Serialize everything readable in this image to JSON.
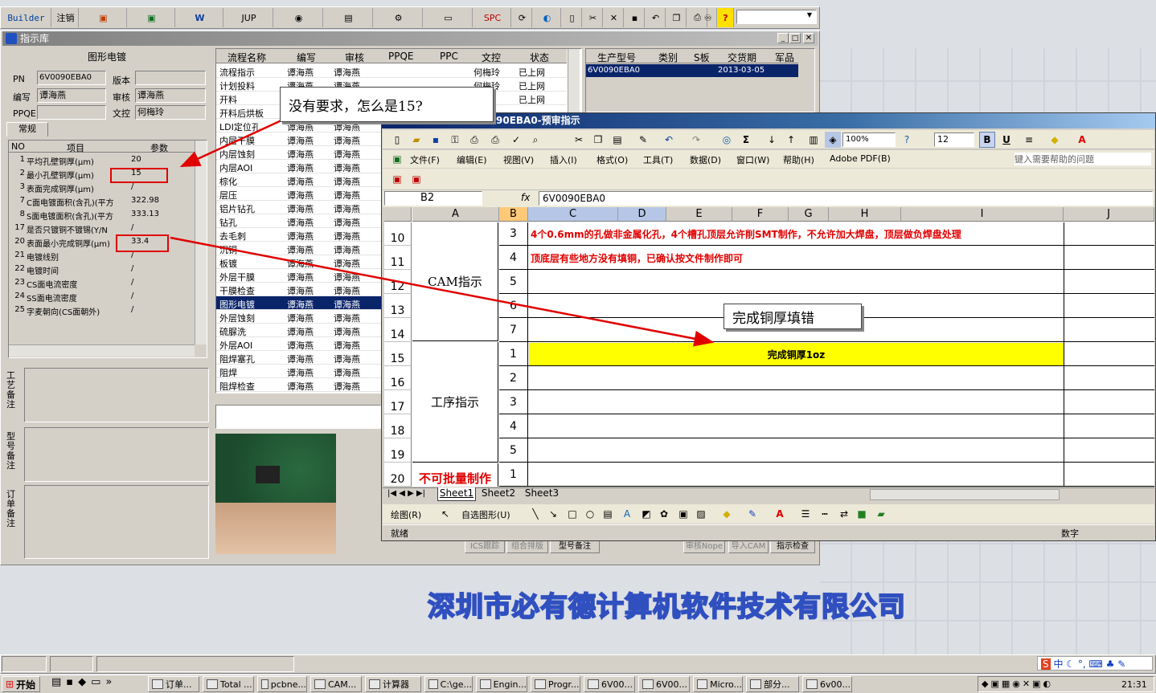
{
  "toolbar": {
    "builder": "Builder",
    "logout": "注销",
    "jup": "JUP",
    "spc": "SPC"
  },
  "panel": {
    "title": "指示库",
    "section": "图形电镀",
    "pn_label": "PN",
    "pn_value": "6V0090EBA0",
    "version_label": "版本",
    "editor_label": "编写",
    "editor_value": "谭海燕",
    "reviewer_label": "审核",
    "reviewer_value": "谭海燕",
    "pqpe_label": "PPQE",
    "docctrl_label": "文控",
    "docctrl_value": "何梅玲",
    "tab": "常规"
  },
  "param_table": {
    "headers": [
      "NO",
      "项目",
      "参数"
    ],
    "rows": [
      {
        "no": "1",
        "item": "平均孔壁铜厚(μm)",
        "val": "20"
      },
      {
        "no": "2",
        "item": "最小孔壁铜厚(μm)",
        "val": "15"
      },
      {
        "no": "3",
        "item": "表面完成铜厚(μm)",
        "val": "/"
      },
      {
        "no": "7",
        "item": "C面电镀面积(含孔)(平方",
        "val": "322.98"
      },
      {
        "no": "8",
        "item": "S面电镀面积(含孔)(平方",
        "val": "333.13"
      },
      {
        "no": "17",
        "item": "是否只镀铜不镀锡(Y/N",
        "val": "/"
      },
      {
        "no": "20",
        "item": "表面最小完成铜厚(μm)",
        "val": "33.4"
      },
      {
        "no": "21",
        "item": "电镀线别",
        "val": "/"
      },
      {
        "no": "22",
        "item": "电镀时间",
        "val": "/"
      },
      {
        "no": "23",
        "item": "CS面电流密度",
        "val": "/"
      },
      {
        "no": "24",
        "item": "SS面电流密度",
        "val": "/"
      },
      {
        "no": "25",
        "item": "字麦朝向(CS面朝外)",
        "val": "/"
      }
    ]
  },
  "notes": {
    "process": "工艺备注",
    "model": "型号备注",
    "order": "订单备注"
  },
  "flow_table": {
    "headers": [
      "流程名称",
      "编写",
      "审核",
      "PPQE",
      "PPC",
      "文控",
      "状态"
    ],
    "rows": [
      {
        "name": "流程指示",
        "w": "谭海燕",
        "r": "谭海燕",
        "dc": "何梅玲",
        "st": "已上网"
      },
      {
        "name": "计划投料",
        "w": "谭海燕",
        "r": "谭海燕",
        "dc": "何梅玲",
        "st": "已上网"
      },
      {
        "name": "开料",
        "w": "谭海燕",
        "r": "谭海燕",
        "dc": "",
        "st": "已上网"
      },
      {
        "name": "开料后烘板",
        "w": "谭海燕",
        "r": "谭海燕",
        "dc": "",
        "st": ""
      },
      {
        "name": "LDI定位孔",
        "w": "谭海燕",
        "r": "谭海燕",
        "dc": "",
        "st": ""
      },
      {
        "name": "内层干膜",
        "w": "谭海燕",
        "r": "谭海燕",
        "dc": "",
        "st": ""
      },
      {
        "name": "内层蚀刻",
        "w": "谭海燕",
        "r": "谭海燕",
        "dc": "",
        "st": ""
      },
      {
        "name": "内层AOI",
        "w": "谭海燕",
        "r": "谭海燕",
        "dc": "",
        "st": ""
      },
      {
        "name": "棕化",
        "w": "谭海燕",
        "r": "谭海燕",
        "dc": "",
        "st": ""
      },
      {
        "name": "层压",
        "w": "谭海燕",
        "r": "谭海燕",
        "dc": "",
        "st": ""
      },
      {
        "name": "铝片钻孔",
        "w": "谭海燕",
        "r": "谭海燕",
        "dc": "",
        "st": ""
      },
      {
        "name": "钻孔",
        "w": "谭海燕",
        "r": "谭海燕",
        "dc": "",
        "st": ""
      },
      {
        "name": "去毛刺",
        "w": "谭海燕",
        "r": "谭海燕",
        "dc": "",
        "st": ""
      },
      {
        "name": "沉铜",
        "w": "谭海燕",
        "r": "谭海燕",
        "dc": "",
        "st": ""
      },
      {
        "name": "板镀",
        "w": "谭海燕",
        "r": "谭海燕",
        "dc": "",
        "st": ""
      },
      {
        "name": "外层干膜",
        "w": "谭海燕",
        "r": "谭海燕",
        "dc": "",
        "st": ""
      },
      {
        "name": "干膜检查",
        "w": "谭海燕",
        "r": "谭海燕",
        "dc": "",
        "st": ""
      },
      {
        "name": "图形电镀",
        "w": "谭海燕",
        "r": "谭海燕",
        "dc": "",
        "st": ""
      },
      {
        "name": "外层蚀刻",
        "w": "谭海燕",
        "r": "谭海燕",
        "dc": "",
        "st": ""
      },
      {
        "name": "硫脲洗",
        "w": "谭海燕",
        "r": "谭海燕",
        "dc": "",
        "st": ""
      },
      {
        "name": "外层AOI",
        "w": "谭海燕",
        "r": "谭海燕",
        "dc": "",
        "st": ""
      },
      {
        "name": "阻焊塞孔",
        "w": "谭海燕",
        "r": "谭海燕",
        "dc": "",
        "st": ""
      },
      {
        "name": "阻焊",
        "w": "谭海燕",
        "r": "谭海燕",
        "dc": "",
        "st": ""
      },
      {
        "name": "阻焊检查",
        "w": "谭海燕",
        "r": "谭海燕",
        "dc": "",
        "st": ""
      }
    ]
  },
  "prod_table": {
    "headers": [
      "生产型号",
      "类别",
      "S板",
      "交货期",
      "军品"
    ],
    "row": {
      "model": "6V0090EBA0",
      "date": "2013-03-05"
    }
  },
  "excel": {
    "title": "6V0090EBA0-预审指示",
    "title_partial": "90EBA0-预审指示",
    "zoom": "100%",
    "font_size": "12",
    "menu": [
      "文件(F)",
      "编辑(E)",
      "视图(V)",
      "插入(I)",
      "格式(O)",
      "工具(T)",
      "数据(D)",
      "窗口(W)",
      "帮助(H)",
      "Adobe PDF(B)"
    ],
    "help_placeholder": "键入需要帮助的问题",
    "namebox": "B2",
    "formula": "6V0090EBA0",
    "cols": [
      "A",
      "B",
      "C",
      "D",
      "E",
      "F",
      "G",
      "H",
      "I",
      "J"
    ],
    "rows": [
      "10",
      "11",
      "12",
      "13",
      "14",
      "15",
      "16",
      "17",
      "18",
      "19",
      "20"
    ],
    "a_cam": "CAM指示",
    "a_proc": "工序指示",
    "a_nobatch": "不可批量制作",
    "b_vals": [
      "3",
      "4",
      "5",
      "6",
      "7",
      "1",
      "2",
      "3",
      "4",
      "5",
      "1"
    ],
    "c10": "4个0.6mm的孔做非金属化孔，4个槽孔顶层允许削SMT制作，不允许加大焊盘，顶层做负焊盘处理",
    "c11": "顶底层有些地方没有填铜，已确认按文件制作即可",
    "c15": "完成铜厚1oz",
    "sheets": [
      "Sheet1",
      "Sheet2",
      "Sheet3"
    ],
    "draw": "绘图(R)",
    "autoshape": "自选图形(U)",
    "status_ready": "就绪",
    "status_num": "数字"
  },
  "callouts": {
    "c1": "没有要求，怎么是15?",
    "c2": "完成铜厚填错"
  },
  "bottom_tabs": [
    "ICS跟踪",
    "组合排版",
    "型号备注",
    "审核Nope",
    "导入CAM",
    "指示检查"
  ],
  "watermark": "深圳市必有德计算机软件技术有限公司",
  "taskbar": {
    "start": "开始",
    "items": [
      "订单...",
      "Total ...",
      "pcbne...",
      "CAM...",
      "计算器",
      "C:\\ge...",
      "Engin...",
      "Progr...",
      "6V00...",
      "6V00...",
      "Micro...",
      "部分...",
      "6v00..."
    ],
    "clock": "21:31",
    "ime": "中"
  }
}
